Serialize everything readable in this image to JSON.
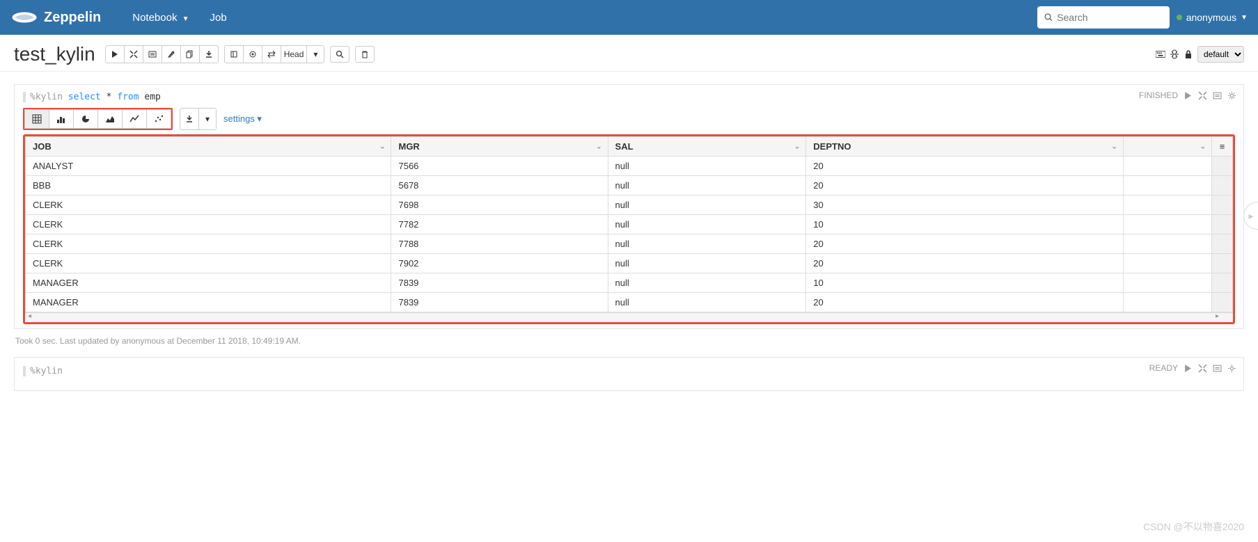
{
  "brand": "Zeppelin",
  "nav": {
    "notebook": "Notebook",
    "job": "Job"
  },
  "search": {
    "placeholder": "Search"
  },
  "user": {
    "name": "anonymous"
  },
  "note": {
    "title": "test_kylin",
    "head_label": "Head",
    "mode_label": "default"
  },
  "para1": {
    "code_prefix": "%kylin ",
    "code_kw": "select",
    "code_mid": " * ",
    "code_kw2": "from",
    "code_rest": " emp",
    "status": "FINISHED",
    "settings": "settings",
    "columns": [
      "JOB",
      "MGR",
      "SAL",
      "DEPTNO",
      ""
    ],
    "rows": [
      [
        "ANALYST",
        "7566",
        "null",
        "20",
        ""
      ],
      [
        "BBB",
        "5678",
        "null",
        "20",
        ""
      ],
      [
        "CLERK",
        "7698",
        "null",
        "30",
        ""
      ],
      [
        "CLERK",
        "7782",
        "null",
        "10",
        ""
      ],
      [
        "CLERK",
        "7788",
        "null",
        "20",
        ""
      ],
      [
        "CLERK",
        "7902",
        "null",
        "20",
        ""
      ],
      [
        "MANAGER",
        "7839",
        "null",
        "10",
        ""
      ],
      [
        "MANAGER",
        "7839",
        "null",
        "20",
        ""
      ]
    ],
    "footer": "Took 0 sec. Last updated by anonymous at December 11 2018, 10:49:19 AM."
  },
  "para2": {
    "code": "%kylin",
    "status": "READY"
  },
  "watermark": "CSDN @不以物喜2020"
}
